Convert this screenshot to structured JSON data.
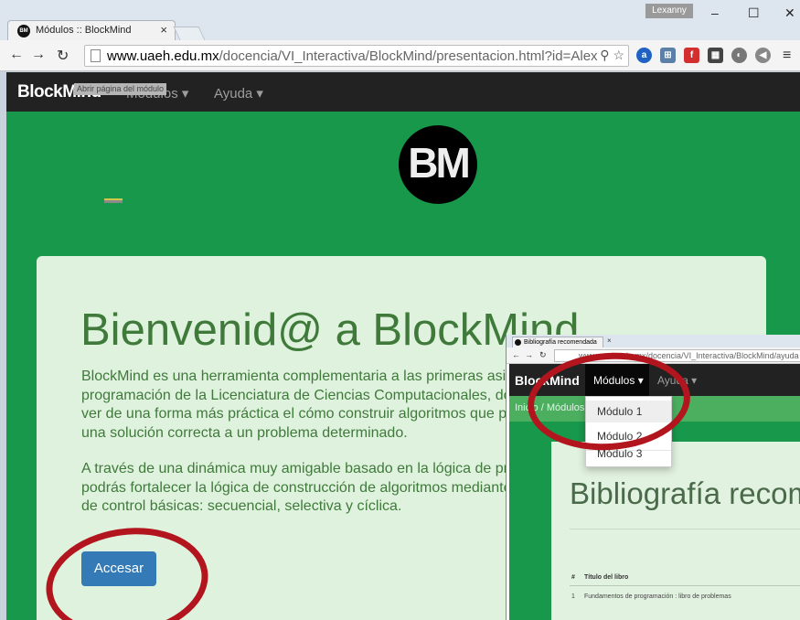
{
  "browser": {
    "tab_title": "Módulos :: BlockMind",
    "tab_favicon_text": "BM",
    "profile_name": "Lexanny",
    "url_host": "www.uaeh.edu.mx",
    "url_path": "/docencia/VI_Interactiva/BlockMind/presentacion.html?id=Alex",
    "window_controls": [
      "–",
      "☐",
      "✕"
    ]
  },
  "navbar": {
    "brand": "BlockMind",
    "modulos_label": "Módulos ▾",
    "ayuda_label": "Ayuda ▾",
    "tooltip": "Abrir página del módulo"
  },
  "logo_text": "BM",
  "jumbotron": {
    "title": "Bienvenid@ a BlockMind",
    "paragraph1": "BlockMind es una herramienta complementaria a las primeras asignaturas de programación de la Licenciatura de Ciencias Computacionales, donde podrás ver de una forma más práctica el cómo construir algoritmos que permitan dar una solución correcta a un problema determinado.",
    "paragraph2": "A través de una dinámica muy amigable basado en la lógica de programación, podrás fortalecer la lógica de construcción de algoritmos mediante estructuras de control básicas: secuencial, selectiva y cíclica.",
    "button": "Accesar"
  },
  "inset": {
    "tab_title": "Bibliografía recomendada",
    "url": "www.uaeh.edu.mx/docencia/VI_Interactiva/BlockMind/ayuda",
    "brand": "BlockMind",
    "modulos_label": "Módulos ▾",
    "ayuda_label": "Ayuda ▾",
    "breadcrumb": "Inicio / Módulos",
    "dropdown": [
      "Módulo 1",
      "Módulo 2",
      "Módulo 3"
    ],
    "heading": "Bibliografía recomendada",
    "table_headers": [
      "#",
      "Título del libro"
    ],
    "table_rows": [
      [
        "1",
        "Fundamentos de programación : libro de problemas"
      ]
    ]
  },
  "colors": {
    "page_green": "#17984a",
    "jumbotron_bg": "#dff2dd",
    "title_green": "#3f7a3b",
    "button_blue": "#337ab7",
    "annotation_red": "#b2151e"
  }
}
